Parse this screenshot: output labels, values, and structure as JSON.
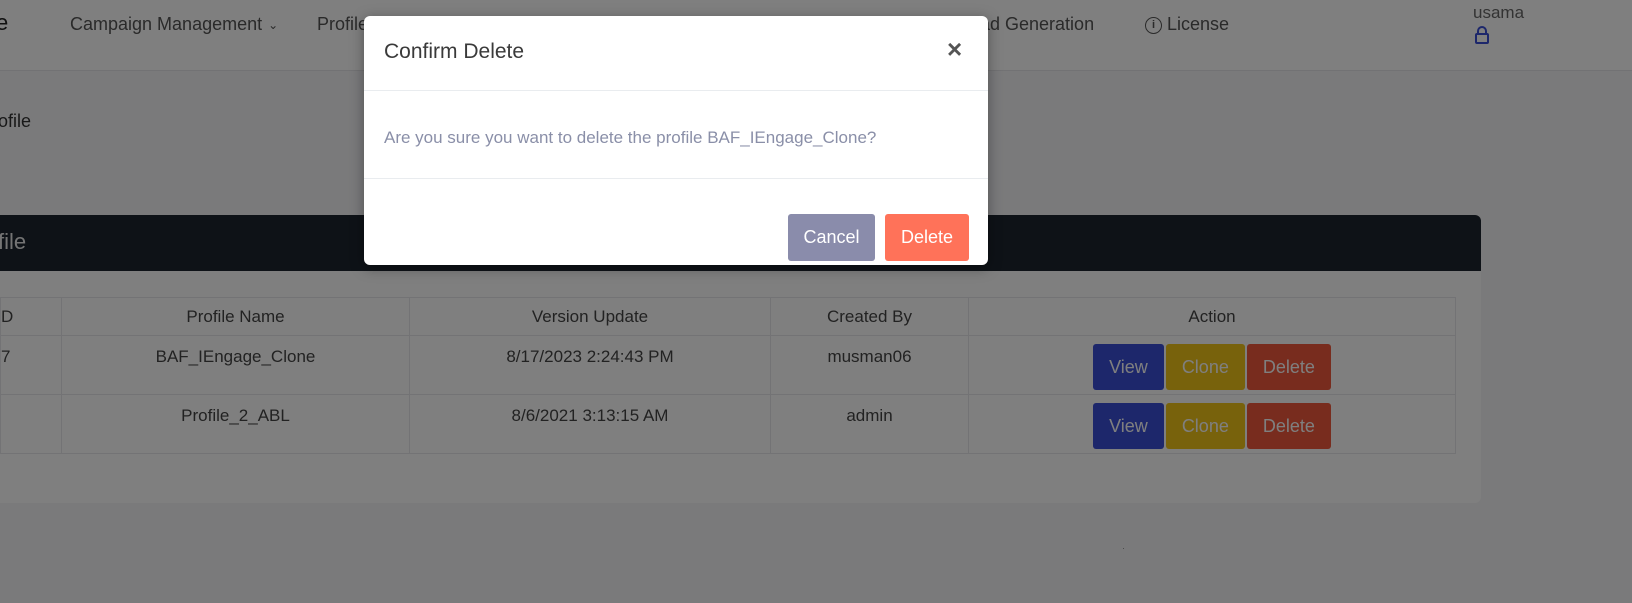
{
  "nav": {
    "brand_fragment": "e",
    "items": [
      {
        "label": "Campaign Management",
        "dropdown": true
      },
      {
        "label": "Profile",
        "dropdown": false
      },
      {
        "label": "ad Generation",
        "dropdown": false
      },
      {
        "label": "License",
        "dropdown": false
      }
    ],
    "user": {
      "name": "usama"
    }
  },
  "page": {
    "heading": "ofile"
  },
  "card": {
    "title": "file",
    "columns": [
      "D",
      "Profile Name",
      "Version Update",
      "Created By",
      "Action"
    ],
    "rows": [
      {
        "id": "7",
        "profile_name": "BAF_IEngage_Clone",
        "version_update": "8/17/2023 2:24:43 PM",
        "created_by": "musman06"
      },
      {
        "id": "",
        "profile_name": "Profile_2_ABL",
        "version_update": "8/6/2021 3:13:15 AM",
        "created_by": "admin"
      }
    ],
    "actions": {
      "view": "View",
      "clone": "Clone",
      "delete": "Delete"
    }
  },
  "modal": {
    "title": "Confirm Delete",
    "close_symbol": "×",
    "message": "Are you sure you want to delete the profile BAF_IEngage_Clone?",
    "cancel_label": "Cancel",
    "confirm_label": "Delete"
  },
  "colors": {
    "view": "#3a4fd6",
    "clone": "#f0c419",
    "delete": "#f0593c",
    "cancel": "#8a8cab",
    "confirm": "#ff7259",
    "card_header": "#1c252f"
  }
}
